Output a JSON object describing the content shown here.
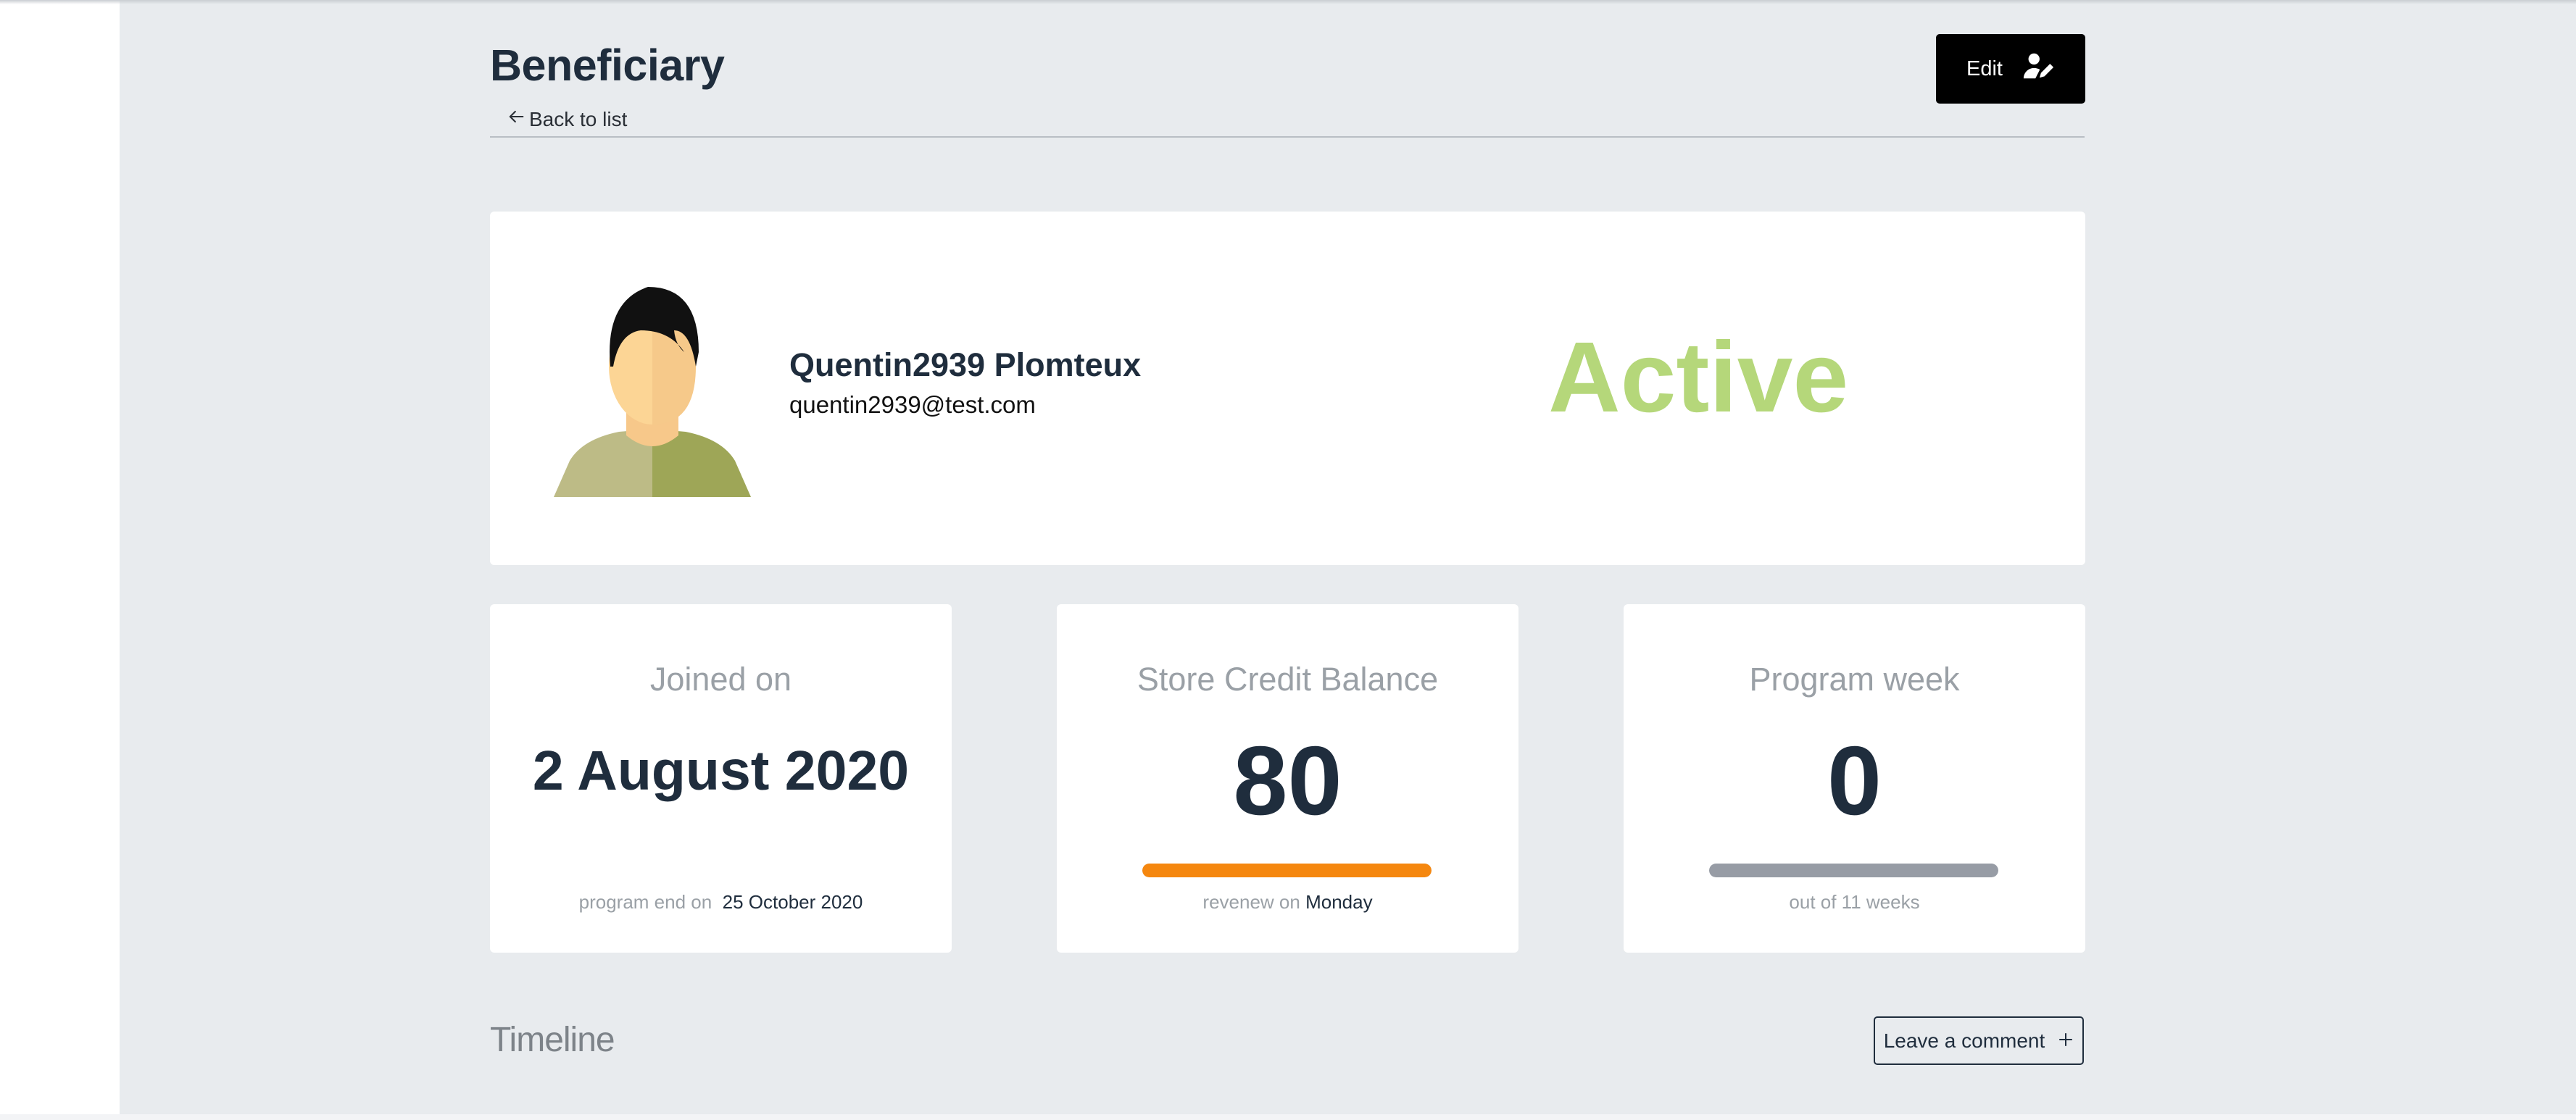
{
  "header": {
    "title": "Beneficiary",
    "back_label": "Back to list",
    "edit_label": "Edit"
  },
  "profile": {
    "name": "Quentin2939 Plomteux",
    "email": "quentin2939@test.com",
    "status": "Active",
    "status_color": "#b5d77a"
  },
  "stats": {
    "joined": {
      "title": "Joined on",
      "value": "2 August 2020",
      "foot_label": "program end on",
      "foot_value": "25 October 2020"
    },
    "credit": {
      "title": "Store Credit Balance",
      "value": "80",
      "progress": 1.0,
      "bar_color": "#f5870f",
      "foot_label": "revenew on",
      "foot_value": "Monday"
    },
    "week": {
      "title": "Program week",
      "value": "0",
      "progress": 1.0,
      "bar_color": "#979ca5",
      "foot_label": "out of 11 weeks"
    }
  },
  "timeline": {
    "title": "Timeline",
    "comment_label": "Leave a comment"
  },
  "icons": {
    "back": "arrow-left-icon",
    "edit": "user-edit-icon",
    "comment": "plus-icon"
  },
  "colors": {
    "background": "#e8ebee",
    "edit_button": "#000000"
  }
}
